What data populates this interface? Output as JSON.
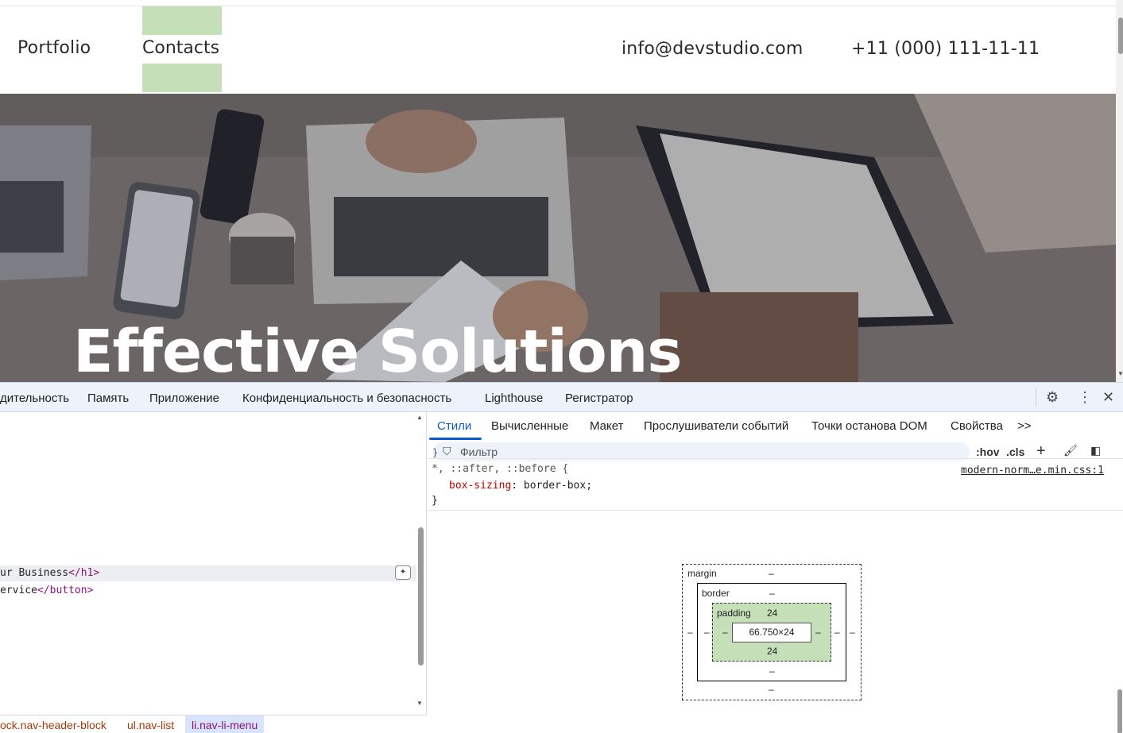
{
  "site": {
    "nav": {
      "portfolio": "Portfolio",
      "contacts": "Contacts",
      "email": "info@devstudio.com",
      "phone": "+11 (000) 111-11-11"
    },
    "hero": {
      "title": "Effective Solutions"
    }
  },
  "devtools": {
    "panel_tabs": [
      "дительность",
      "Память",
      "Приложение",
      "Конфиденциальность и безопасность",
      "Lighthouse",
      "Регистратор"
    ],
    "elements": {
      "line1_text": "ur Business",
      "line1_tag": "</h1>",
      "line2_text": "ervice",
      "line2_tag": "</button>",
      "breadcrumbs": [
        "ock.nav-header-block",
        "ul.nav-list",
        "li.nav-li-menu"
      ]
    },
    "styles": {
      "subtabs": [
        "Стили",
        "Вычисленные",
        "Макет",
        "Прослушиватели событий",
        "Точки останова DOM",
        "Свойства"
      ],
      "more": ">>",
      "filter_placeholder": "Фильтр",
      "tool_hov": ":hov",
      "tool_cls": ".cls",
      "rule_selector": "*, ::after, ::before {",
      "rule_property": "box-sizing",
      "rule_value": ": border-box;",
      "rule_close": "}",
      "rule_source": "modern-norm…e.min.css:1",
      "prev_close": "}"
    },
    "box_model": {
      "margin_label": "margin",
      "border_label": "border",
      "padding_label": "padding",
      "margin_top": "–",
      "margin_bottom": "–",
      "margin_left": "–",
      "margin_right": "–",
      "border_top": "–",
      "border_bottom": "–",
      "border_left": "–",
      "border_right": "–",
      "padding_top": "24",
      "padding_bottom": "24",
      "padding_left": "–",
      "padding_right": "–",
      "content": "66.750×24"
    }
  }
}
